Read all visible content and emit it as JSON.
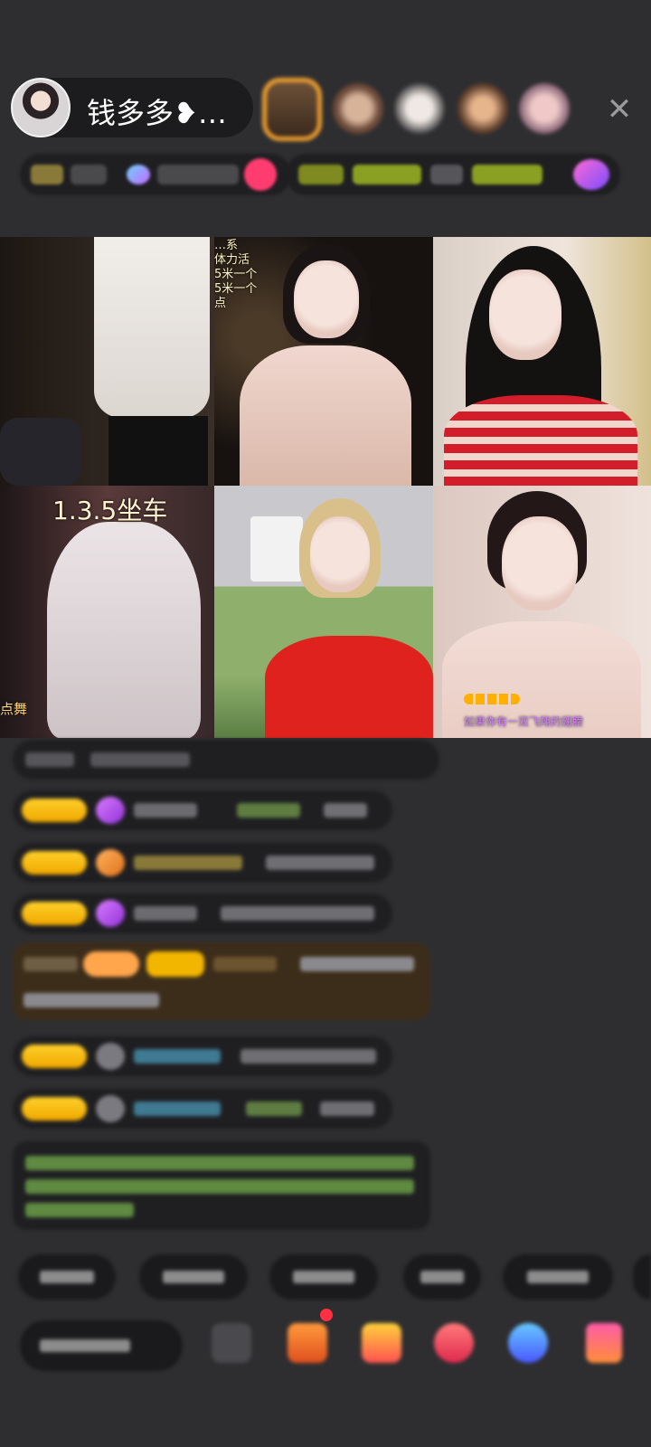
{
  "header": {
    "host_name": "钱多多❥…",
    "viewer_avatars": [
      {
        "name": "viewer-avatar-1",
        "color": "#7a5a3a"
      },
      {
        "name": "viewer-avatar-2",
        "color": "#8e6a55"
      },
      {
        "name": "viewer-avatar-3",
        "color": "#bdb3ad"
      },
      {
        "name": "viewer-avatar-4",
        "color": "#6e5546"
      },
      {
        "name": "viewer-avatar-5",
        "color": "#b49ba2"
      }
    ],
    "close_icon": "close-icon"
  },
  "grid": {
    "cells": [
      {
        "overlay": ""
      },
      {
        "overlay_lines": [
          "…系",
          "体力活",
          "5米一个",
          "5米一个",
          "点"
        ]
      },
      {
        "overlay": ""
      },
      {
        "overlay_title": "1.3.5坐车",
        "overlay_bottom": "点舞"
      },
      {
        "overlay": ""
      },
      {
        "overlay_caption": "如果你有一双飞翔的翅膀"
      }
    ]
  },
  "colors": {
    "background": "#2e2e31",
    "badge_gold": "#f0a800",
    "accent_orange": "#f0a030",
    "caption_purple": "#d07cff"
  }
}
